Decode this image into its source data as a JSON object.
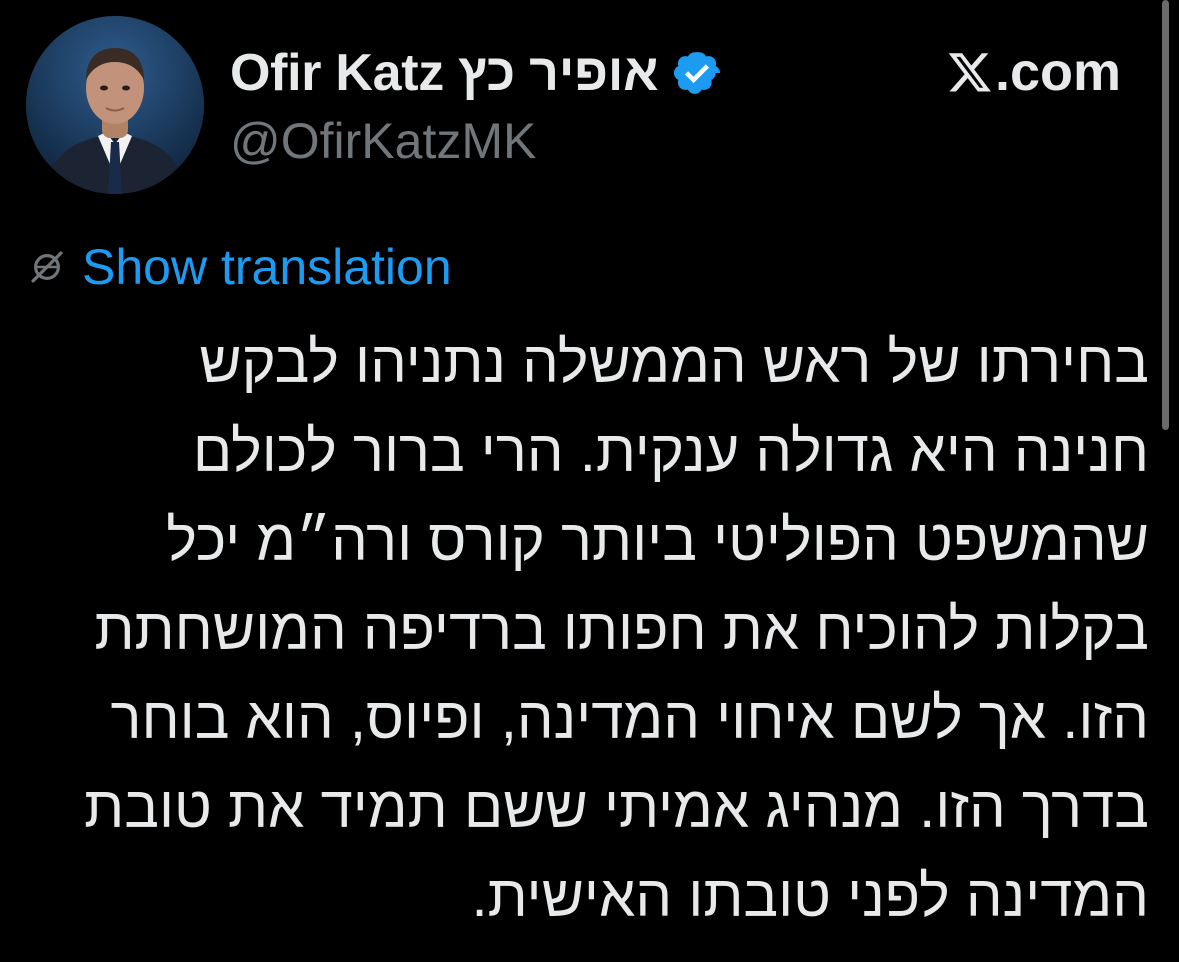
{
  "author": {
    "display_name": "Ofir Katz אופיר כץ",
    "handle": "@OfirKatzMK",
    "verified_icon": "verified-badge-icon",
    "verified_color": "#1d9bf0"
  },
  "brand": {
    "logo_icon": "x-logo-icon",
    "text": ".com"
  },
  "translation": {
    "icon": "globe-slash-icon",
    "label": "Show translation",
    "link_color": "#1d9bf0"
  },
  "tweet": {
    "lines": [
      "בחירתו של ראש הממשלה נתניהו לבקש",
      "חנינה היא גדולה ענקית. הרי ברור לכולם",
      "שהמשפט הפוליטי ביותר קורס ורה״מ יכל",
      "בקלות להוכיח את חפותו ברדיפה המושחתת",
      "הזו. אך לשם איחוי המדינה, ופיוס, הוא בוחר",
      "בדרך הזו. מנהיג אמיתי ששם תמיד את טובת",
      "המדינה לפני טובתו האישית."
    ]
  },
  "theme": {
    "background": "#000000",
    "text_primary": "#e7e9ea",
    "text_secondary": "#71767b"
  }
}
